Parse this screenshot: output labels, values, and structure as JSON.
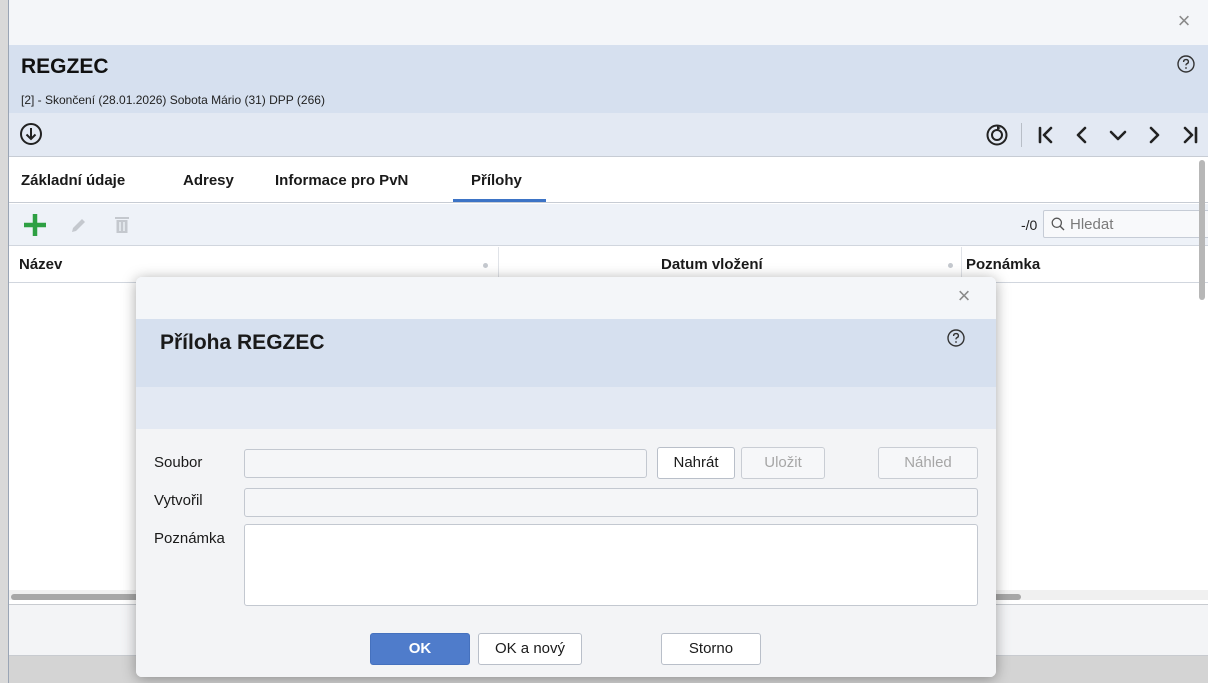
{
  "window": {
    "title": "REGZEC",
    "subtitle": "[2] - Skončení (28.01.2026) Sobota Mário (31) DPP (266)",
    "close_glyph": "×",
    "icons": {
      "close": "close-icon",
      "help": "help-icon",
      "download": "download-circle-icon",
      "refresh": "refresh-icon",
      "first": "first-record-icon",
      "prev": "previous-record-icon",
      "menu": "chevron-down-icon",
      "next": "next-record-icon",
      "last": "last-record-icon"
    }
  },
  "tabs": [
    {
      "label": "Základní údaje",
      "active": false
    },
    {
      "label": "Adresy",
      "active": false
    },
    {
      "label": "Informace pro PvN",
      "active": false
    },
    {
      "label": "Přílohy",
      "active": true
    }
  ],
  "table_toolbar": {
    "count": "-/0",
    "search_placeholder": "Hledat",
    "add_color": "#2ea043",
    "icons": {
      "add": "add-icon",
      "edit": "pencil-icon",
      "delete": "trash-icon",
      "search": "search-icon"
    }
  },
  "grid": {
    "columns": [
      "Název",
      "Datum vložení",
      "Poznámka"
    ],
    "rows": []
  },
  "dialog": {
    "title": "Příloha REGZEC",
    "close_glyph": "×",
    "fields": {
      "soubor_label": "Soubor",
      "soubor_value": "",
      "vytvoril_label": "Vytvořil",
      "vytvoril_value": "",
      "poznamka_label": "Poznámka",
      "poznamka_value": ""
    },
    "buttons": {
      "upload": "Nahrát",
      "save": "Uložit",
      "preview": "Náhled",
      "ok": "OK",
      "ok_new": "OK a nový",
      "cancel": "Storno"
    },
    "accent_color": "#4f7ccb"
  }
}
